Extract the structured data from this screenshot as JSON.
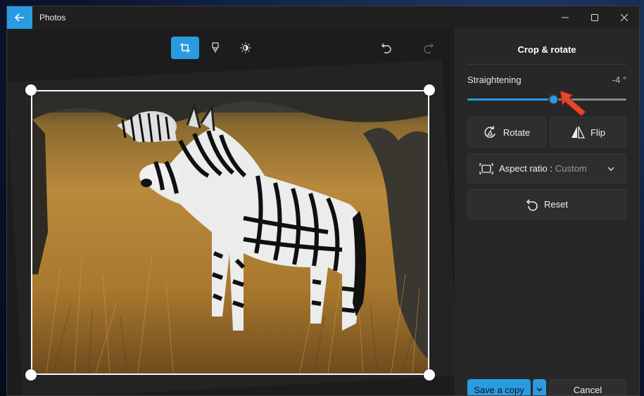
{
  "window": {
    "title": "Photos"
  },
  "toolbar": {
    "tools": [
      {
        "icon": "crop-icon",
        "active": true
      },
      {
        "icon": "markup-icon",
        "active": false
      },
      {
        "icon": "brightness-icon",
        "active": false
      }
    ],
    "undo_icon": "undo-icon",
    "redo_icon": "redo-icon"
  },
  "panel": {
    "title": "Crop & rotate",
    "straightening": {
      "label": "Straightening",
      "value_text": "-4 °",
      "fill_fraction": 0.54
    },
    "rotate_label": "Rotate",
    "flip_label": "Flip",
    "aspect_ratio": {
      "label": "Aspect ratio :",
      "value": "Custom"
    },
    "reset_label": "Reset"
  },
  "actions": {
    "save_label": "Save a copy",
    "cancel_label": "Cancel"
  },
  "colors": {
    "accent": "#2a9be0",
    "pointer": "#e8462b"
  }
}
